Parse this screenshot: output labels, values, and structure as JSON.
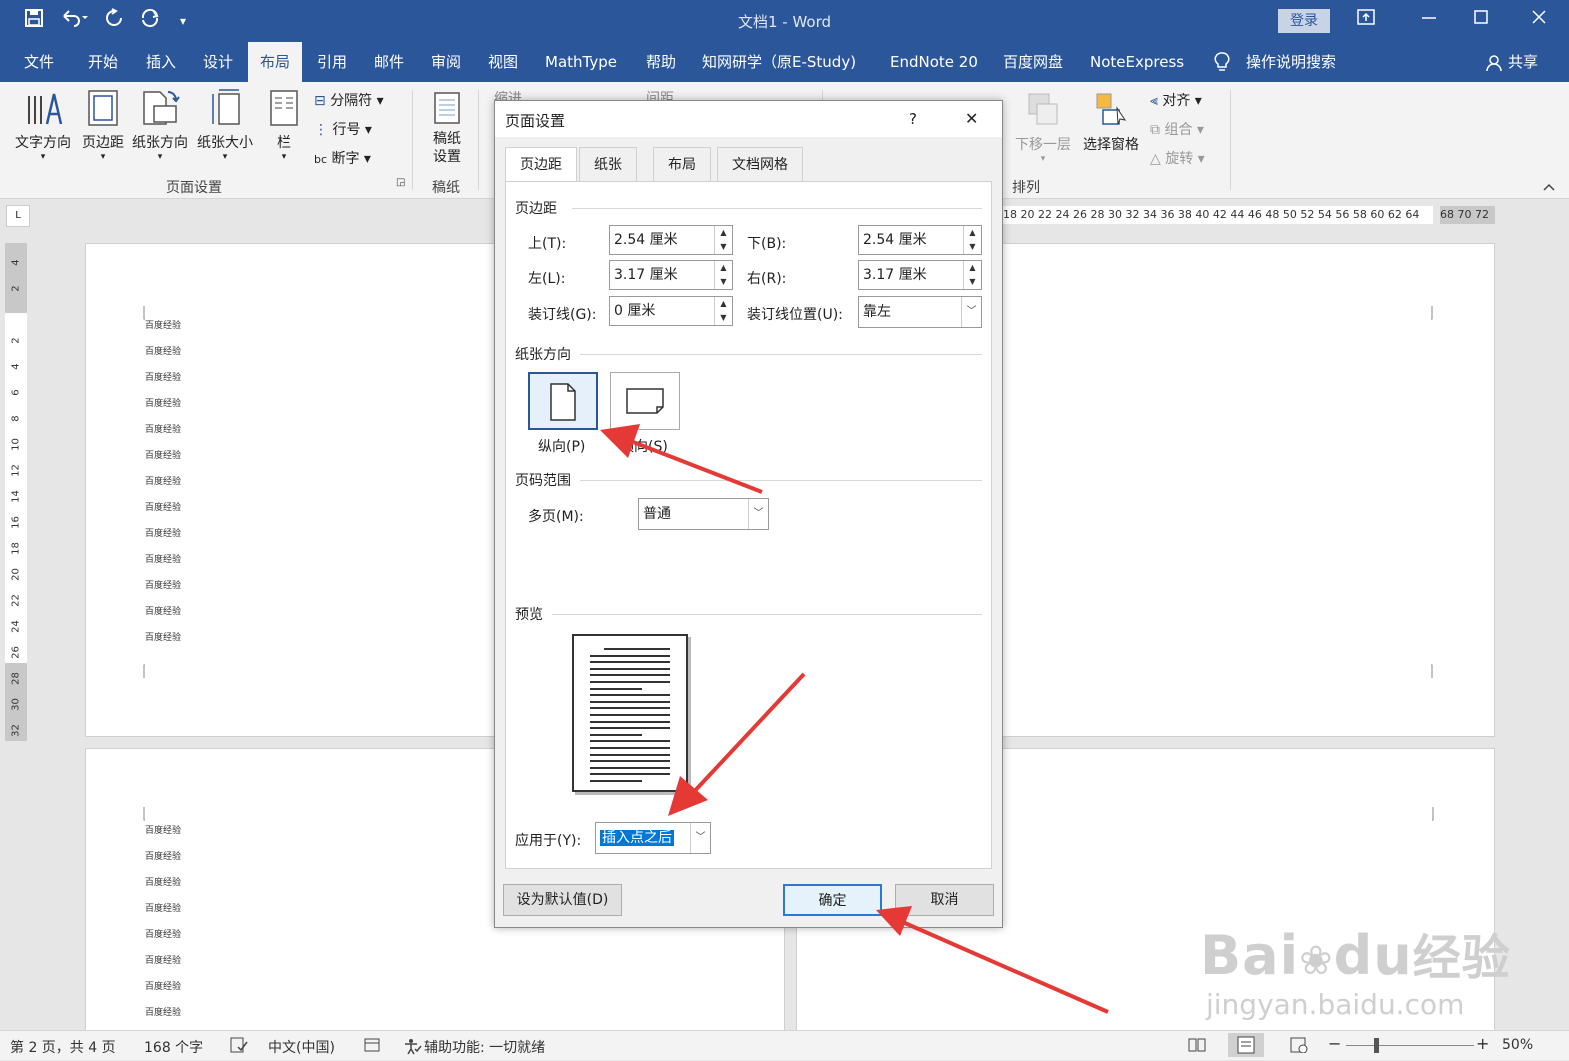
{
  "window": {
    "title": "文档1 - Word",
    "login_label": "登录"
  },
  "menu": {
    "tabs": [
      "文件",
      "开始",
      "插入",
      "设计",
      "布局",
      "引用",
      "邮件",
      "审阅",
      "视图",
      "MathType",
      "帮助",
      "知网研学（原E-Study)",
      "EndNote 20",
      "百度网盘",
      "NoteExpress"
    ],
    "search_label": "操作说明搜索",
    "share_label": "共享"
  },
  "ribbon": {
    "text_direction": "文字方向",
    "margins": "页边距",
    "orientation": "纸张方向",
    "size": "纸张大小",
    "columns": "栏",
    "breaks": "分隔符",
    "line_numbers": "行号",
    "hyphenation": "断字",
    "page_setup_group": "页面设置",
    "draft_setup": "稿纸设置",
    "draft_group": "稿纸",
    "indent": "缩进",
    "spacing": "间距",
    "send_backward": "下移一层",
    "selection_pane": "选择窗格",
    "align": "对齐",
    "group": "组合",
    "rotate": "旋转",
    "arrange_group": "排列"
  },
  "ruler": {
    "h_ticks": "18 20 22 24 26 28 30 32 34 36 38 40 42 44 46 48 50 52 54 56 58 60 62 64",
    "h_tail": "68 70 72",
    "v_ticks": [
      "4",
      "2",
      "",
      "2",
      "4",
      "6",
      "8",
      "10",
      "12",
      "14",
      "16",
      "18",
      "20",
      "22",
      "24",
      "26",
      "28",
      "30",
      "32"
    ]
  },
  "document": {
    "page1_lines": [
      "百度经验",
      "百度经验",
      "百度经验",
      "百度经验",
      "百度经验",
      "百度经验",
      "百度经验",
      "百度经验",
      "百度经验",
      "百度经验",
      "百度经验",
      "百度经验",
      "百度经验"
    ],
    "page2_lines": [
      "百度经验",
      "百度经验",
      "百度经验",
      "百度经验",
      "百度经验",
      "百度经验",
      "百度经验",
      "百度经验"
    ]
  },
  "dialog": {
    "title": "页面设置",
    "help": "?",
    "close": "✕",
    "tabs": [
      "页边距",
      "纸张",
      "布局",
      "文档网格"
    ],
    "margins_section": "页边距",
    "top_label": "上(T):",
    "top_value": "2.54 厘米",
    "bottom_label": "下(B):",
    "bottom_value": "2.54 厘米",
    "left_label": "左(L):",
    "left_value": "3.17 厘米",
    "right_label": "右(R):",
    "right_value": "3.17 厘米",
    "gutter_label": "装订线(G):",
    "gutter_value": "0 厘米",
    "gutter_pos_label": "装订线位置(U):",
    "gutter_pos_value": "靠左",
    "orientation_section": "纸张方向",
    "portrait_label": "纵向(P)",
    "landscape_label": "横向(S)",
    "pages_section": "页码范围",
    "multiple_pages_label": "多页(M):",
    "multiple_pages_value": "普通",
    "preview_section": "预览",
    "apply_label": "应用于(Y):",
    "apply_value": "插入点之后",
    "default_button": "设为默认值(D)",
    "ok_button": "确定",
    "cancel_button": "取消"
  },
  "status": {
    "page": "第 2 页，共 4 页",
    "words": "168 个字",
    "language": "中文(中国)",
    "accessibility": "辅助功能: 一切就绪",
    "zoom": "50%"
  },
  "watermark": {
    "brand": "Bai",
    "brand2": "du",
    "jingyan": "经验",
    "url": "jingyan.baidu.com"
  },
  "colors": {
    "title_bar": "#2b579a",
    "ribbon": "#f3f3f3",
    "annotation_arrow": "#e53935",
    "selection": "#0078d7"
  }
}
